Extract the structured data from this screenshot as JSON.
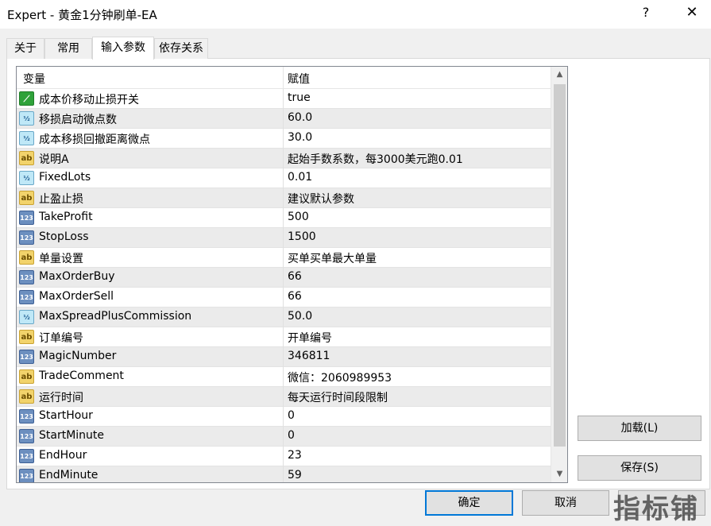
{
  "window": {
    "title": "Expert - 黄金1分钟刷单-EA",
    "help": "?",
    "close": "✕"
  },
  "tabs": [
    {
      "label": "关于"
    },
    {
      "label": "常用"
    },
    {
      "label": "输入参数"
    },
    {
      "label": "依存关系"
    }
  ],
  "grid": {
    "col_variable": "变量",
    "col_value": "赋值",
    "rows": [
      {
        "icon": "bool-icon",
        "name": "成本价移动止损开关",
        "value": "true"
      },
      {
        "icon": "double-icon",
        "name": "移损启动微点数",
        "value": "60.0"
      },
      {
        "icon": "double-icon",
        "name": "成本移损回撤距离微点",
        "value": "30.0"
      },
      {
        "icon": "string-icon",
        "name": "说明A",
        "value": "起始手数系数，每3000美元跑0.01"
      },
      {
        "icon": "double-icon",
        "name": "FixedLots",
        "value": "0.01"
      },
      {
        "icon": "string-icon",
        "name": "止盈止损",
        "value": "建议默认参数"
      },
      {
        "icon": "int-icon",
        "name": "TakeProfit",
        "value": "500"
      },
      {
        "icon": "int-icon",
        "name": "StopLoss",
        "value": "1500"
      },
      {
        "icon": "string-icon",
        "name": "单量设置",
        "value": "买单买单最大单量"
      },
      {
        "icon": "int-icon",
        "name": "MaxOrderBuy",
        "value": "66"
      },
      {
        "icon": "int-icon",
        "name": "MaxOrderSell",
        "value": "66"
      },
      {
        "icon": "double-icon",
        "name": "MaxSpreadPlusCommission",
        "value": "50.0"
      },
      {
        "icon": "string-icon",
        "name": "订单编号",
        "value": "开单编号"
      },
      {
        "icon": "int-icon",
        "name": "MagicNumber",
        "value": "346811"
      },
      {
        "icon": "string-icon",
        "name": "TradeComment",
        "value": "微信：2060989953"
      },
      {
        "icon": "string-icon",
        "name": "运行时间",
        "value": "每天运行时间段限制"
      },
      {
        "icon": "int-icon",
        "name": "StartHour",
        "value": "0"
      },
      {
        "icon": "int-icon",
        "name": "StartMinute",
        "value": "0"
      },
      {
        "icon": "int-icon",
        "name": "EndHour",
        "value": "23"
      },
      {
        "icon": "int-icon",
        "name": "EndMinute",
        "value": "59"
      }
    ]
  },
  "icon_glyphs": {
    "bool-icon": "⟋",
    "double-icon": "½",
    "string-icon": "ab",
    "int-icon": "123"
  },
  "buttons": {
    "load": "加载(L)",
    "save": "保存(S)",
    "ok": "确定",
    "cancel": "取消"
  },
  "watermark": "指标铺"
}
